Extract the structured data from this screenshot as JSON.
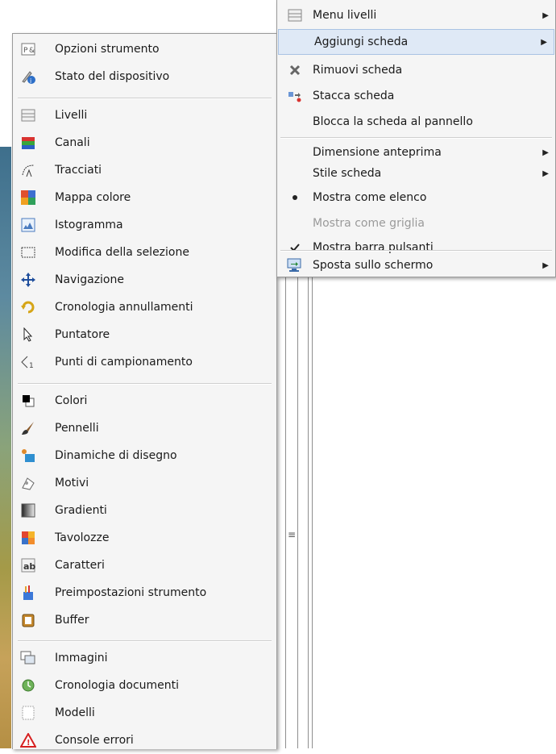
{
  "left_menu": {
    "groups": [
      [
        {
          "label": "Opzioni strumento",
          "icon": "tool-options-icon"
        },
        {
          "label": "Stato del dispositivo",
          "icon": "device-status-icon"
        }
      ],
      [
        {
          "label": "Livelli",
          "icon": "layers-icon"
        },
        {
          "label": "Canali",
          "icon": "channels-icon"
        },
        {
          "label": "Tracciati",
          "icon": "paths-icon"
        },
        {
          "label": "Mappa colore",
          "icon": "colormap-icon"
        },
        {
          "label": "Istogramma",
          "icon": "histogram-icon"
        },
        {
          "label": "Modifica della selezione",
          "icon": "selection-editor-icon"
        },
        {
          "label": "Navigazione",
          "icon": "navigation-icon"
        },
        {
          "label": "Cronologia annullamenti",
          "icon": "undo-history-icon"
        },
        {
          "label": "Puntatore",
          "icon": "pointer-icon"
        },
        {
          "label": "Punti di campionamento",
          "icon": "sample-points-icon"
        }
      ],
      [
        {
          "label": "Colori",
          "icon": "colors-icon"
        },
        {
          "label": "Pennelli",
          "icon": "brushes-icon"
        },
        {
          "label": "Dinamiche di disegno",
          "icon": "paint-dynamics-icon"
        },
        {
          "label": "Motivi",
          "icon": "patterns-icon"
        },
        {
          "label": "Gradienti",
          "icon": "gradients-icon"
        },
        {
          "label": "Tavolozze",
          "icon": "palettes-icon"
        },
        {
          "label": "Caratteri",
          "icon": "fonts-icon"
        },
        {
          "label": "Preimpostazioni strumento",
          "icon": "tool-presets-icon"
        },
        {
          "label": "Buffer",
          "icon": "buffers-icon"
        }
      ],
      [
        {
          "label": "Immagini",
          "icon": "images-icon"
        },
        {
          "label": "Cronologia documenti",
          "icon": "document-history-icon"
        },
        {
          "label": "Modelli",
          "icon": "templates-icon"
        },
        {
          "label": "Console errori",
          "icon": "error-console-icon"
        }
      ]
    ]
  },
  "right_menu": {
    "groups": [
      [
        {
          "label": "Menu livelli",
          "icon": "layers-icon",
          "submenu": true
        },
        {
          "label": "Aggiungi scheda",
          "icon": "",
          "submenu": true,
          "highlighted": true
        },
        {
          "label": "Rimuovi scheda",
          "icon": "close-tab-icon"
        },
        {
          "label": "Stacca scheda",
          "icon": "detach-tab-icon"
        },
        {
          "label": "Blocca la scheda al pannello",
          "icon": ""
        }
      ],
      [
        {
          "label": "Dimensione anteprima",
          "icon": "",
          "submenu": true
        },
        {
          "label": "Stile scheda",
          "icon": "",
          "submenu": true
        },
        {
          "label": "Mostra come elenco",
          "icon": "radio-bullet-icon"
        },
        {
          "label": "Mostra come griglia",
          "icon": "",
          "disabled": true
        },
        {
          "label": "Mostra barra pulsanti",
          "icon": "checkmark-icon"
        }
      ],
      [
        {
          "label": "Sposta sullo schermo",
          "icon": "move-to-screen-icon",
          "submenu": true
        }
      ]
    ]
  },
  "colors": {
    "menu_bg": "#f5f5f5",
    "highlight_bg": "#dfe9f6",
    "highlight_border": "#a9c3e4",
    "disabled_text": "#9a9a9a"
  }
}
